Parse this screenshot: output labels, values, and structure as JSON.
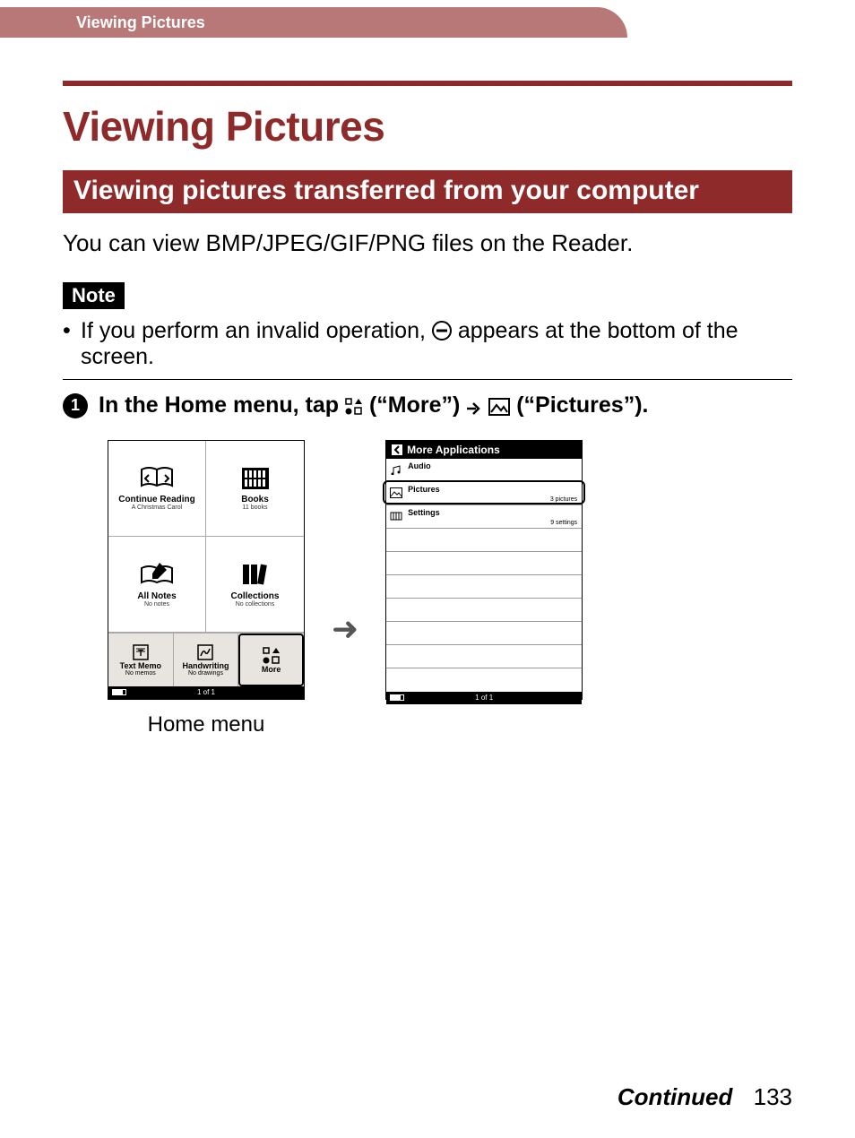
{
  "header": {
    "breadcrumb": "Viewing Pictures"
  },
  "page_title": "Viewing Pictures",
  "section_title": "Viewing pictures transferred from your computer",
  "intro": "You can view BMP/JPEG/GIF/PNG files on the Reader.",
  "note_label": "Note",
  "note_text_before": "If you perform an invalid operation, ",
  "note_text_after": " appears at the bottom of the screen.",
  "step": {
    "number": "1",
    "text_before": "In the Home menu, tap ",
    "more_label": " (“More”) ",
    "pictures_label": " (“Pictures”)."
  },
  "home_menu": {
    "caption": "Home menu",
    "cells": [
      {
        "title": "Continue Reading",
        "sub": "A Christmas Carol"
      },
      {
        "title": "Books",
        "sub": "11 books"
      },
      {
        "title": "All Notes",
        "sub": "No notes"
      },
      {
        "title": "Collections",
        "sub": "No collections"
      }
    ],
    "bottom": [
      {
        "title": "Text Memo",
        "sub": "No memos"
      },
      {
        "title": "Handwriting",
        "sub": "No drawings"
      },
      {
        "title": "More",
        "sub": ""
      }
    ],
    "status": "1 of 1"
  },
  "more_apps": {
    "header": "More Applications",
    "rows": [
      {
        "label": "Audio",
        "count": ""
      },
      {
        "label": "Pictures",
        "count": "3 pictures",
        "highlight": true
      },
      {
        "label": "Settings",
        "count": "9 settings"
      }
    ],
    "status": "1 of 1"
  },
  "footer": {
    "continued": "Continued",
    "page": "133"
  }
}
